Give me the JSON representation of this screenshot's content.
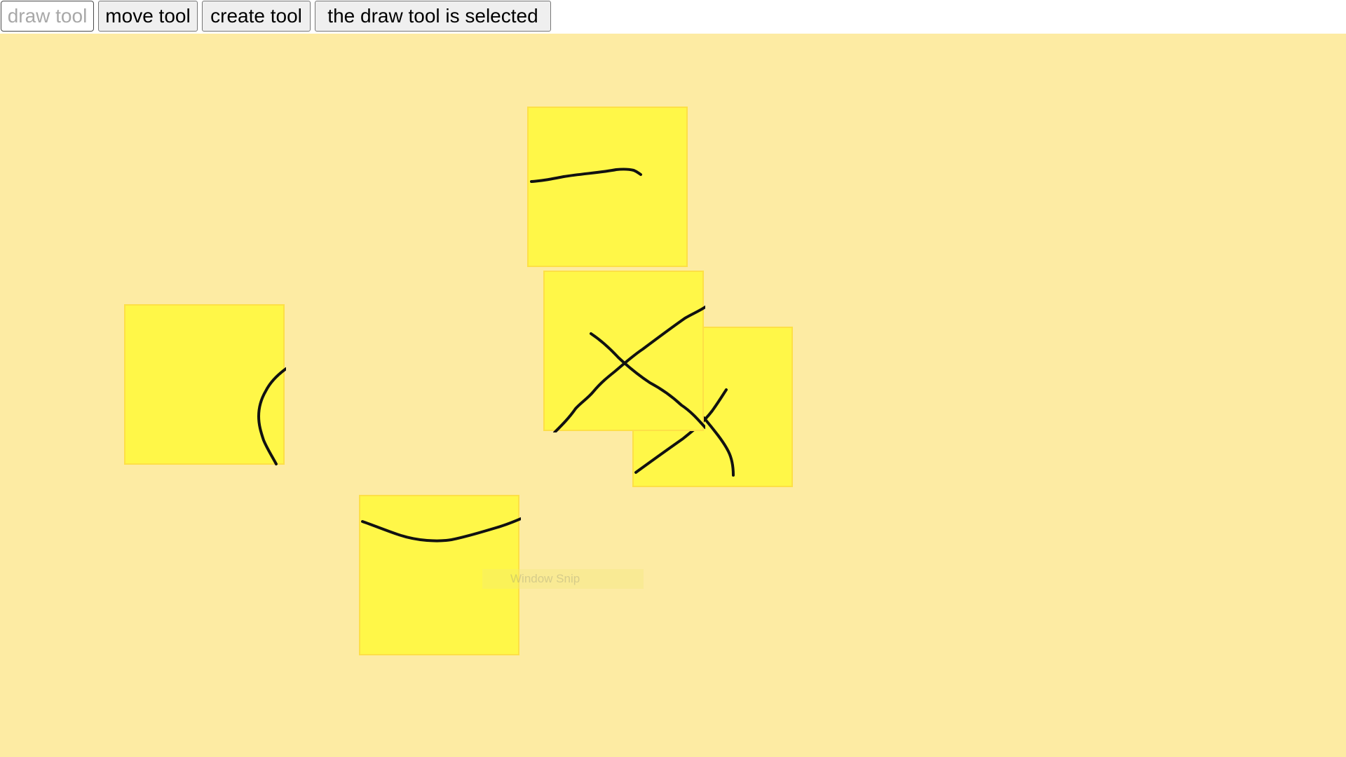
{
  "toolbar": {
    "draw_tool_label": "draw tool",
    "move_tool_label": "move tool",
    "create_tool_label": "create tool",
    "status_label": "the draw tool is selected",
    "selected_tool": "draw"
  },
  "canvas": {
    "background_color": "#fdeba3",
    "note_color": "#fff748",
    "stroke_color": "#111111",
    "notes_count": 5
  },
  "overlay": {
    "snip_hint_text": "Window Snip"
  }
}
